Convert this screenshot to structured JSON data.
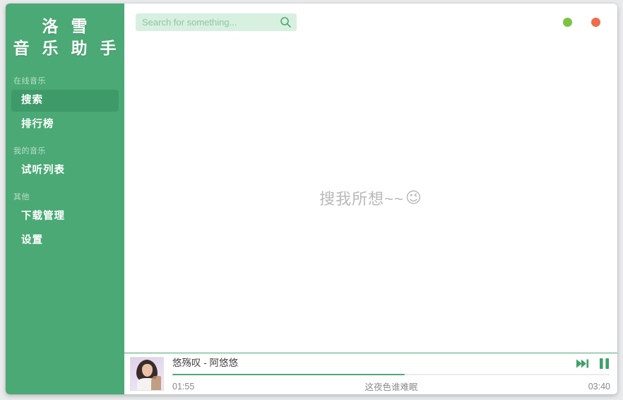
{
  "window": {
    "controls": [
      {
        "name": "minimize-button",
        "label": "",
        "color": "#7cc344"
      },
      {
        "name": "close-button",
        "label": "",
        "color": "#ef6c4a"
      }
    ]
  },
  "sidebar": {
    "logo": {
      "line1": "洛 雪",
      "line2": "音 乐 助 手"
    },
    "sections": [
      {
        "label": "在线音乐",
        "items": [
          {
            "label": "搜索",
            "active": true
          },
          {
            "label": "排行榜",
            "active": false
          }
        ]
      },
      {
        "label": "我的音乐",
        "items": [
          {
            "label": "试听列表",
            "active": false
          }
        ]
      },
      {
        "label": "其他",
        "items": [
          {
            "label": "下载管理",
            "active": false
          },
          {
            "label": "设置",
            "active": false
          }
        ]
      }
    ],
    "accent": "#4aa974",
    "active_bg": "#3f9a69"
  },
  "search": {
    "value": "",
    "placeholder": "Search for something...",
    "icon": "search-icon"
  },
  "content": {
    "empty_hint_text": "搜我所想~~",
    "empty_hint_emoji": "😉"
  },
  "player": {
    "song_title": "悠殇叹 - 阿悠悠",
    "time_current": "01:55",
    "time_total": "03:40",
    "lyric_line": "这夜色谁难眠",
    "progress_percent": 53,
    "accent": "#4aa974",
    "controls": {
      "next_icon": "next-track-icon",
      "playpause_icon": "pause-icon"
    }
  }
}
